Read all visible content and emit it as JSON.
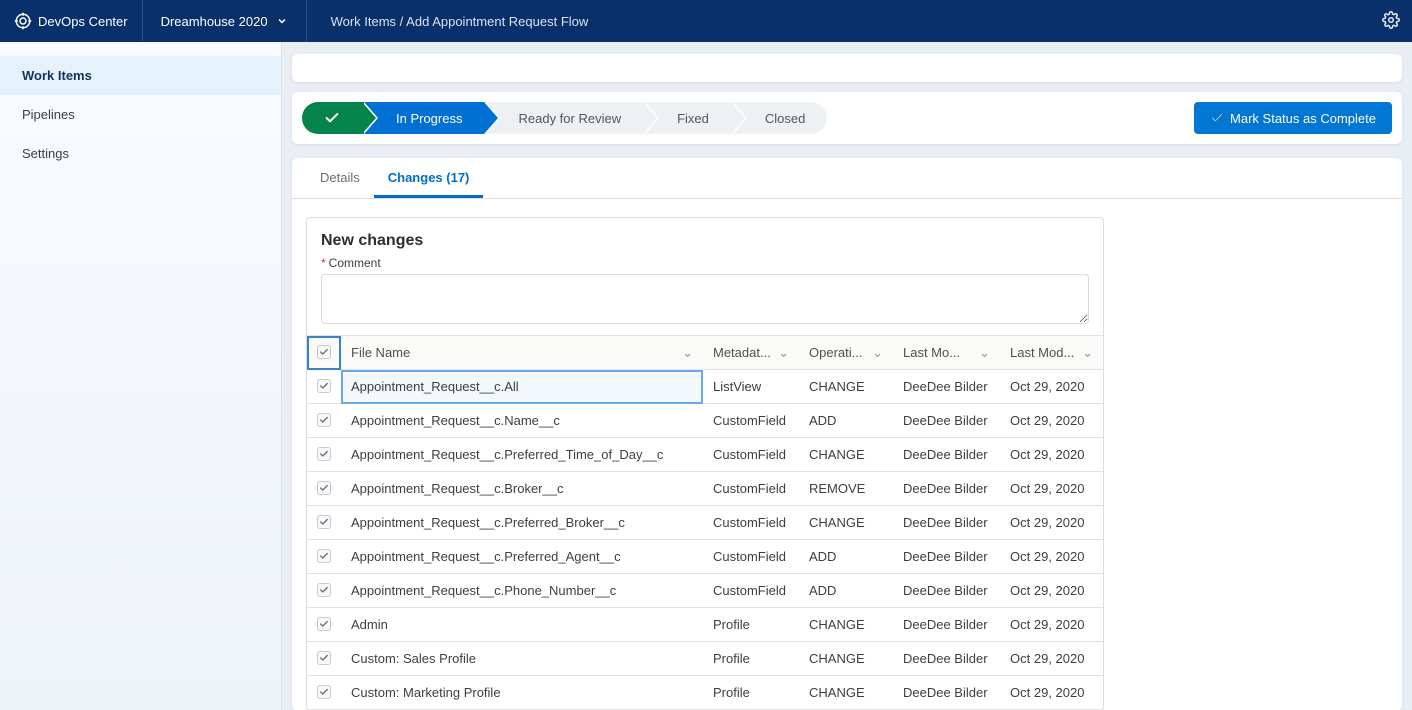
{
  "header": {
    "app_name": "DevOps Center",
    "project_name": "Dreamhouse 2020",
    "breadcrumb": "Work Items / Add Appointment Request Flow"
  },
  "sidebar": {
    "items": [
      {
        "label": "Work Items",
        "active": true
      },
      {
        "label": "Pipelines",
        "active": false
      },
      {
        "label": "Settings",
        "active": false
      }
    ]
  },
  "stages": {
    "items": [
      {
        "label": "",
        "state": "done"
      },
      {
        "label": "In Progress",
        "state": "current"
      },
      {
        "label": "Ready for Review",
        "state": "pending"
      },
      {
        "label": "Fixed",
        "state": "pending"
      },
      {
        "label": "Closed",
        "state": "pending"
      }
    ],
    "action_label": "Mark Status as Complete"
  },
  "tabs": {
    "details_label": "Details",
    "changes_label": "Changes (17)"
  },
  "panel": {
    "title": "New changes",
    "comment_label": "Comment"
  },
  "table": {
    "headers": {
      "file_name": "File Name",
      "metadata": "Metadat...",
      "operation": "Operati...",
      "last_mod_by": "Last Mo...",
      "last_mod_date": "Last Mod..."
    },
    "rows": [
      {
        "file": "Appointment_Request__c.All",
        "meta": "ListView",
        "op": "CHANGE",
        "by": "DeeDee Bilder",
        "date": "Oct 29, 2020",
        "sel": true
      },
      {
        "file": "Appointment_Request__c.Name__c",
        "meta": "CustomField",
        "op": "ADD",
        "by": "DeeDee Bilder",
        "date": "Oct 29, 2020"
      },
      {
        "file": "Appointment_Request__c.Preferred_Time_of_Day__c",
        "meta": "CustomField",
        "op": "CHANGE",
        "by": "DeeDee Bilder",
        "date": "Oct 29, 2020"
      },
      {
        "file": "Appointment_Request__c.Broker__c",
        "meta": "CustomField",
        "op": "REMOVE",
        "by": "DeeDee Bilder",
        "date": "Oct 29, 2020"
      },
      {
        "file": "Appointment_Request__c.Preferred_Broker__c",
        "meta": "CustomField",
        "op": "CHANGE",
        "by": "DeeDee Bilder",
        "date": "Oct 29, 2020"
      },
      {
        "file": "Appointment_Request__c.Preferred_Agent__c",
        "meta": "CustomField",
        "op": "ADD",
        "by": "DeeDee Bilder",
        "date": "Oct 29, 2020"
      },
      {
        "file": "Appointment_Request__c.Phone_Number__c",
        "meta": "CustomField",
        "op": "ADD",
        "by": "DeeDee Bilder",
        "date": "Oct 29, 2020"
      },
      {
        "file": "Admin",
        "meta": "Profile",
        "op": "CHANGE",
        "by": "DeeDee Bilder",
        "date": "Oct 29, 2020"
      },
      {
        "file": "Custom: Sales Profile",
        "meta": "Profile",
        "op": "CHANGE",
        "by": "DeeDee Bilder",
        "date": "Oct 29, 2020"
      },
      {
        "file": "Custom: Marketing Profile",
        "meta": "Profile",
        "op": "CHANGE",
        "by": "DeeDee Bilder",
        "date": "Oct 29, 2020"
      }
    ]
  }
}
